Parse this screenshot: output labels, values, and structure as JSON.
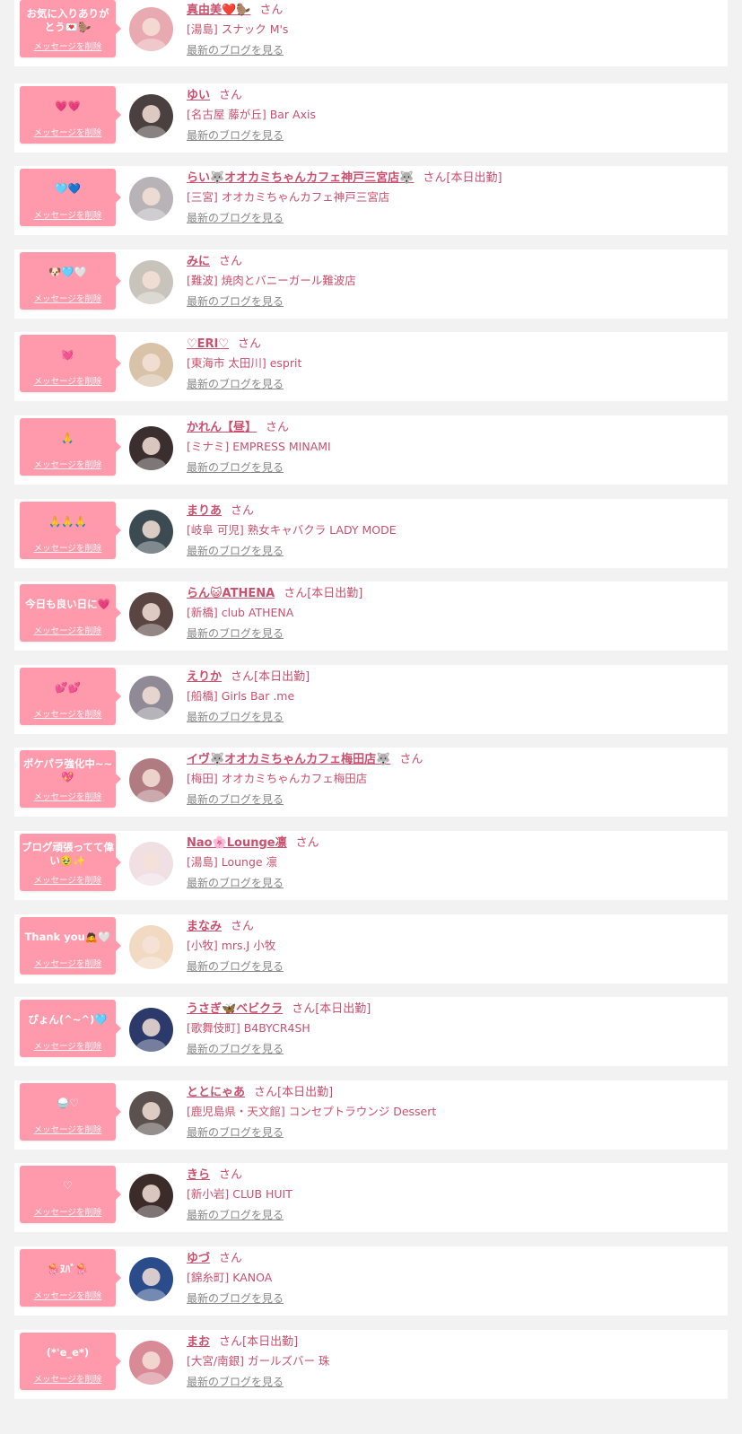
{
  "colors": {
    "page_bg": "#f2f2f2",
    "card_bg": "#ffffff",
    "bubble": "#ff9aac",
    "name_text": "#c9506e",
    "link_gray": "#888888"
  },
  "cards": [
    {
      "message": "お気に入りありがとう💌🦫",
      "delete_label": "メッセージを削除",
      "name": "真由美❤️🦫",
      "honorific": "さん",
      "status": "",
      "shop": "[湯島] スナック M's",
      "blog_link": "最新のブログを見る",
      "avatar_color": "#e8a9b0"
    },
    {
      "message": "💗💗",
      "delete_label": "メッセージを削除",
      "name": "ゆい",
      "honorific": "さん",
      "status": "",
      "shop": "[名古屋 藤が丘] Bar Axis",
      "blog_link": "最新のブログを見る",
      "avatar_color": "#4a4040"
    },
    {
      "message": "🩵💙",
      "delete_label": "メッセージを削除",
      "name": "らい🐺オオカミちゃんカフェ神戸三宮店🐺",
      "honorific": "さん",
      "status": "[本日出勤]",
      "shop": "[三宮] オオカミちゃんカフェ神戸三宮店",
      "blog_link": "最新のブログを見る",
      "avatar_color": "#b7b3b7"
    },
    {
      "message": "🐶🩵🤍",
      "delete_label": "メッセージを削除",
      "name": "みに",
      "honorific": "さん",
      "status": "",
      "shop": "[難波] 焼肉とバニーガール難波店",
      "blog_link": "最新のブログを見る",
      "avatar_color": "#c9c4bb"
    },
    {
      "message": "💓",
      "delete_label": "メッセージを削除",
      "name": "♡ERI♡",
      "honorific": "さん",
      "status": "",
      "shop": "[東海市 太田川] esprit",
      "blog_link": "最新のブログを見る",
      "avatar_color": "#d8c2a8"
    },
    {
      "message": "🙏",
      "delete_label": "メッセージを削除",
      "name": "かれん【昼】",
      "honorific": "さん",
      "status": "",
      "shop": "[ミナミ] EMPRESS MINAMI",
      "blog_link": "最新のブログを見る",
      "avatar_color": "#3a2e2e"
    },
    {
      "message": "🙏🙏🙏",
      "delete_label": "メッセージを削除",
      "name": "まりあ",
      "honorific": "さん",
      "status": "",
      "shop": "[岐阜 可児] 熟女キャバクラ LADY MODE",
      "blog_link": "最新のブログを見る",
      "avatar_color": "#3c4a52"
    },
    {
      "message": "今日も良い日に💗",
      "delete_label": "メッセージを削除",
      "name": "らん😺ATHENA",
      "honorific": "さん",
      "status": "[本日出勤]",
      "shop": "[新橋] club ATHENA",
      "blog_link": "最新のブログを見る",
      "avatar_color": "#5a4542"
    },
    {
      "message": "💕💕",
      "delete_label": "メッセージを削除",
      "name": "えりか",
      "honorific": "さん",
      "status": "[本日出勤]",
      "shop": "[船橋] Girls Bar .me",
      "blog_link": "最新のブログを見る",
      "avatar_color": "#8f8a95"
    },
    {
      "message": "ポケパラ強化中~~💖",
      "delete_label": "メッセージを削除",
      "name": "イヴ🐺オオカミちゃんカフェ梅田店🐺",
      "honorific": "さん",
      "status": "",
      "shop": "[梅田] オオカミちゃんカフェ梅田店",
      "blog_link": "最新のブログを見る",
      "avatar_color": "#b07c82"
    },
    {
      "message": "ブログ頑張ってて偉い🥹✨",
      "delete_label": "メッセージを削除",
      "name": "Nao🌸Lounge凛",
      "honorific": "さん",
      "status": "",
      "shop": "[湯島] Lounge 凛",
      "blog_link": "最新のブログを見る",
      "avatar_color": "#f0dfe3"
    },
    {
      "message": "Thank you🙇🤍",
      "delete_label": "メッセージを削除",
      "name": "まなみ",
      "honorific": "さん",
      "status": "",
      "shop": "[小牧] mrs.J 小牧",
      "blog_link": "最新のブログを見る",
      "avatar_color": "#f1d9c2"
    },
    {
      "message": "ぴょん(^~^)🩵",
      "delete_label": "メッセージを削除",
      "name": "うさぎ🦋ベビクラ",
      "honorific": "さん",
      "status": "[本日出勤]",
      "shop": "[歌舞伎町] B4BYCR4SH",
      "blog_link": "最新のブログを見る",
      "avatar_color": "#2c3a6b"
    },
    {
      "message": "🍚♡",
      "delete_label": "メッセージを削除",
      "name": "ととにゃあ",
      "honorific": "さん",
      "status": "[本日出勤]",
      "shop": "[鹿児島県・天文館] コンセプトラウンジ Dessert",
      "blog_link": "最新のブログを見る",
      "avatar_color": "#5b5250"
    },
    {
      "message": "♡",
      "delete_label": "メッセージを削除",
      "name": "きら",
      "honorific": "さん",
      "status": "",
      "shop": "[新小岩] CLUB HUIT",
      "blog_link": "最新のブログを見る",
      "avatar_color": "#3b2c2a"
    },
    {
      "message": "🪼ﾇﾊﾞ🪼",
      "delete_label": "メッセージを削除",
      "name": "ゆづ",
      "honorific": "さん",
      "status": "",
      "shop": "[錦糸町] KANOA",
      "blog_link": "最新のブログを見る",
      "avatar_color": "#2b4c8a"
    },
    {
      "message": "(*'e_e*)",
      "delete_label": "メッセージを削除",
      "name": "まお",
      "honorific": "さん",
      "status": "[本日出勤]",
      "shop": "[大宮/南銀] ガールズバー 珠",
      "blog_link": "最新のブログを見る",
      "avatar_color": "#d88a96"
    }
  ]
}
